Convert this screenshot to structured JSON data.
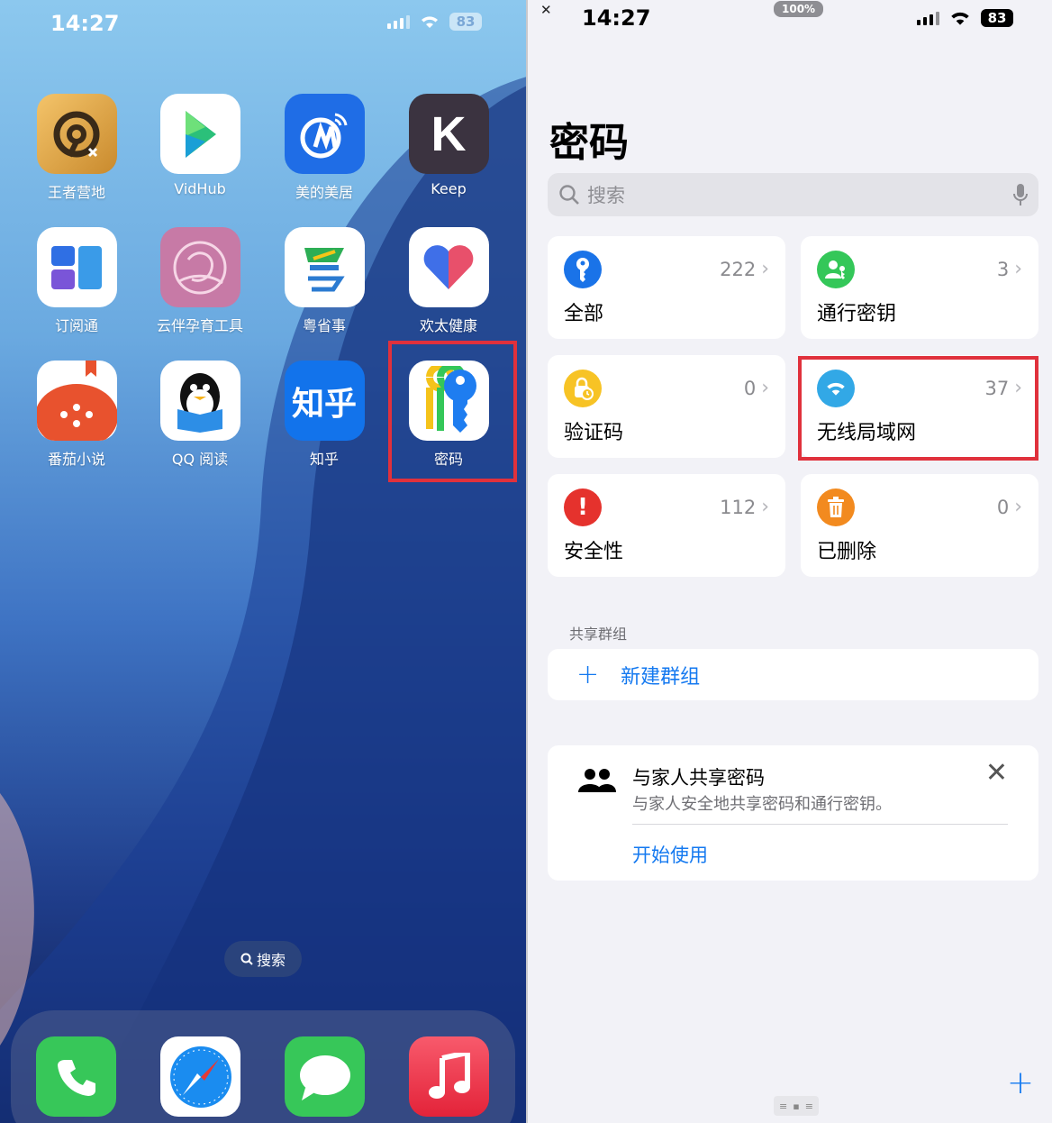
{
  "home": {
    "status_time": "14:27",
    "battery": "83",
    "apps": [
      {
        "label": "王者营地",
        "icon": "wangzhe-yingdi-icon"
      },
      {
        "label": "VidHub",
        "icon": "vidhub-icon"
      },
      {
        "label": "美的美居",
        "icon": "midea-icon"
      },
      {
        "label": "Keep",
        "icon": "keep-icon"
      },
      {
        "label": "订阅通",
        "icon": "subscription-icon"
      },
      {
        "label": "云伴孕育工具",
        "icon": "pregnancy-tool-icon"
      },
      {
        "label": "粤省事",
        "icon": "yueshengshi-icon"
      },
      {
        "label": "欢太健康",
        "icon": "heytap-health-icon"
      },
      {
        "label": "番茄小说",
        "icon": "fanqie-novel-icon"
      },
      {
        "label": "QQ 阅读",
        "icon": "qq-reading-icon"
      },
      {
        "label": "知乎",
        "icon": "zhihu-icon"
      },
      {
        "label": "密码",
        "icon": "passwords-icon"
      }
    ],
    "icon_text": {
      "zhihu": "知乎",
      "keep": "K"
    },
    "search_label": "搜索",
    "dock": [
      "phone-icon",
      "safari-icon",
      "messages-icon",
      "music-icon"
    ]
  },
  "passwords": {
    "status_time": "14:27",
    "zoom": "100%",
    "battery": "83",
    "title": "密码",
    "search_placeholder": "搜索",
    "categories": [
      {
        "name": "全部",
        "count": "222",
        "color": "#1a73e8",
        "icon": "key-icon"
      },
      {
        "name": "通行密钥",
        "count": "3",
        "color": "#34c759",
        "icon": "passkey-person-icon"
      },
      {
        "name": "验证码",
        "count": "0",
        "color": "#f7c325",
        "icon": "lock-clock-icon"
      },
      {
        "name": "无线局域网",
        "count": "37",
        "color": "#32a8e6",
        "icon": "wifi-icon"
      },
      {
        "name": "安全性",
        "count": "112",
        "color": "#e5322d",
        "icon": "exclamation-icon"
      },
      {
        "name": "已删除",
        "count": "0",
        "color": "#f28a1f",
        "icon": "trash-icon"
      }
    ],
    "shared_groups_header": "共享群组",
    "new_group_label": "新建群组",
    "family": {
      "title": "与家人共享密码",
      "subtitle": "与家人安全地共享密码和通行密钥。",
      "link": "开始使用"
    }
  },
  "colors": {
    "accent": "#1479f0",
    "highlight": "#e0313c"
  }
}
